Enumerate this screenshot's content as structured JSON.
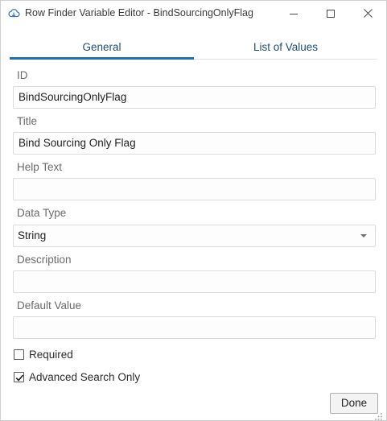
{
  "window": {
    "title": "Row Finder Variable Editor - BindSourcingOnlyFlag",
    "app_icon": "cloud-icon",
    "controls": [
      "minimize-icon",
      "maximize-icon",
      "close-icon"
    ]
  },
  "tabs": [
    {
      "label": "General",
      "selected": true
    },
    {
      "label": "List of Values",
      "selected": false
    }
  ],
  "form": {
    "id": {
      "label": "ID",
      "value": "BindSourcingOnlyFlag"
    },
    "title": {
      "label": "Title",
      "value": "Bind Sourcing Only Flag"
    },
    "help_text": {
      "label": "Help Text",
      "value": ""
    },
    "data_type": {
      "label": "Data Type",
      "value": "String"
    },
    "description": {
      "label": "Description",
      "value": ""
    },
    "default_value": {
      "label": "Default Value",
      "value": ""
    }
  },
  "checkboxes": {
    "required": {
      "label": "Required",
      "checked": false
    },
    "advanced_search_only": {
      "label": "Advanced Search Only",
      "checked": true
    }
  },
  "buttons": {
    "done": "Done"
  },
  "colors": {
    "tab_accent": "#1f6fb2",
    "tab_text": "#1f4e79"
  }
}
